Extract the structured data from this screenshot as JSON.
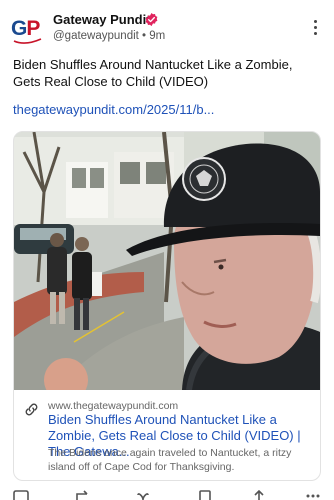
{
  "author": {
    "avatar_text_g": "G",
    "avatar_text_p": "P",
    "name": "Gateway Pundit",
    "handle": "@gatewaypundit",
    "separator": "•",
    "time": "9m",
    "verified_color": "#e0245e"
  },
  "post": {
    "text": "Biden Shuffles Around Nantucket Like a Zombie, Gets Real Close to Child (VIDEO)",
    "link": "thegatewaypundit.com/2025/11/b..."
  },
  "card": {
    "domain": "www.thegatewaypundit.com",
    "title": "Biden Shuffles Around Nantucket Like a Zombie, Gets Real Close to Child (VIDEO) | The Gatewa...",
    "description": "The Bidens once again traveled to Nantucket, a ritzy island off of Cape Cod for Thanksgiving."
  },
  "actions": {
    "icons": [
      "reply-icon",
      "repost-icon",
      "like-icon",
      "share-icon"
    ]
  }
}
